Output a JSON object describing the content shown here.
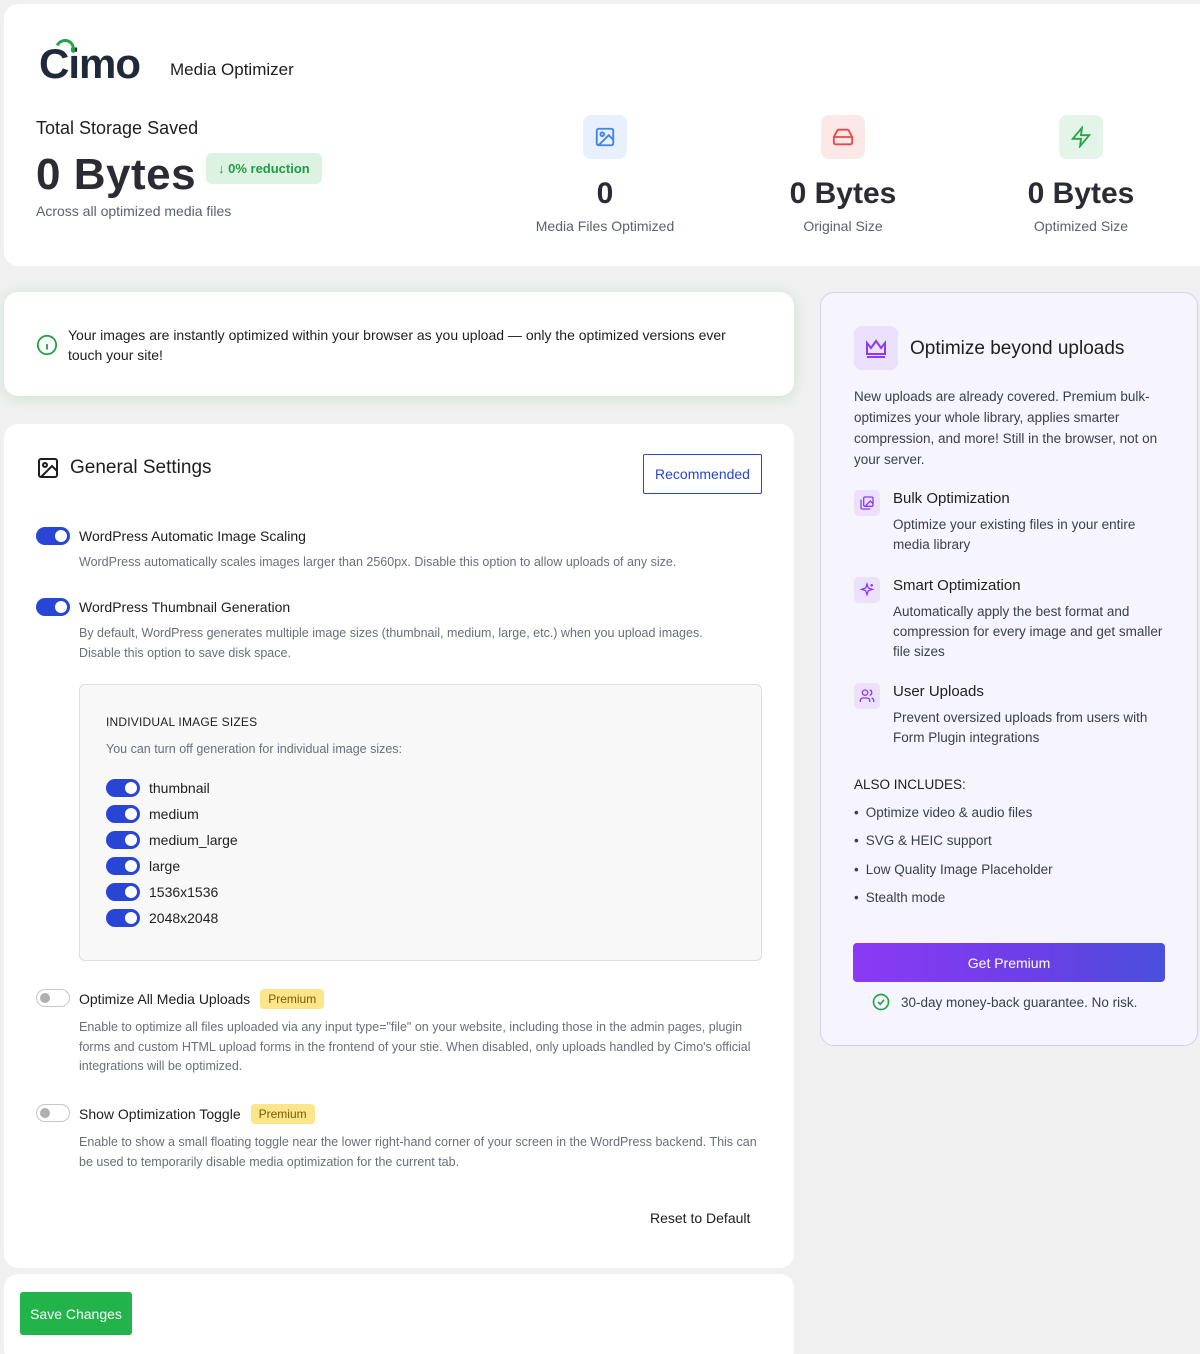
{
  "header": {
    "brand": "Cimo",
    "subtitle": "Media Optimizer",
    "total_label": "Total Storage Saved",
    "total_value": "0 Bytes",
    "reduction_badge": "↓ 0% reduction",
    "total_caption": "Across all optimized media files",
    "stats": [
      {
        "value": "0",
        "label": "Media Files Optimized",
        "icon": "image-icon",
        "color": "#3b82f6"
      },
      {
        "value": "0 Bytes",
        "label": "Original Size",
        "icon": "hard-drive-icon",
        "color": "#ef4444"
      },
      {
        "value": "0 Bytes",
        "label": "Optimized Size",
        "icon": "lightning-icon",
        "color": "#22a447"
      }
    ]
  },
  "info_banner": {
    "text": "Your images are instantly optimized within your browser as you upload — only the optimized versions ever touch your site!"
  },
  "settings": {
    "title": "General Settings",
    "recommended_label": "Recommended",
    "items": [
      {
        "label": "WordPress Automatic Image Scaling",
        "enabled": true,
        "description": "WordPress automatically scales images larger than 2560px. Disable this option to allow uploads of any size."
      },
      {
        "label": "WordPress Thumbnail Generation",
        "enabled": true,
        "description": "By default, WordPress generates multiple image sizes (thumbnail, medium, large, etc.) when you upload images. Disable this option to save disk space."
      },
      {
        "label": "Optimize All Media Uploads",
        "enabled": false,
        "badge": "Premium",
        "description": "Enable to optimize all files uploaded via any input type=\"file\" on your website, including those in the admin pages, plugin forms and custom HTML upload forms in the frontend of your stie. When disabled, only uploads handled by Cimo's official integrations will be optimized."
      },
      {
        "label": "Show Optimization Toggle",
        "enabled": false,
        "badge": "Premium",
        "description": "Enable to show a small floating toggle near the lower right-hand corner of your screen in the WordPress backend. This can be used to temporarily disable media optimization for the current tab."
      }
    ],
    "image_sizes": {
      "title": "INDIVIDUAL IMAGE SIZES",
      "subtitle": "You can turn off generation for individual image sizes:",
      "sizes": [
        {
          "name": "thumbnail",
          "enabled": true
        },
        {
          "name": "medium",
          "enabled": true
        },
        {
          "name": "medium_large",
          "enabled": true
        },
        {
          "name": "large",
          "enabled": true
        },
        {
          "name": "1536x1536",
          "enabled": true
        },
        {
          "name": "2048x2048",
          "enabled": true
        }
      ]
    },
    "reset_label": "Reset to Default"
  },
  "save": {
    "label": "Save Changes"
  },
  "promo": {
    "title": "Optimize beyond uploads",
    "description": "New uploads are already covered. Premium bulk-optimizes your whole library, applies smarter compression, and more! Still in the browser, not on your server.",
    "features": [
      {
        "title": "Bulk Optimization",
        "description": "Optimize your existing files in your entire media library",
        "icon": "images-icon"
      },
      {
        "title": "Smart Optimization",
        "description": "Automatically apply the best format and compression for every image and get smaller file sizes",
        "icon": "sparkles-icon"
      },
      {
        "title": "User Uploads",
        "description": "Prevent oversized uploads from users with Form Plugin integrations",
        "icon": "users-icon"
      }
    ],
    "also_label": "ALSO INCLUDES:",
    "also_items": [
      "Optimize video & audio files",
      "SVG & HEIC support",
      "Low Quality Image Placeholder",
      "Stealth mode"
    ],
    "cta_label": "Get Premium",
    "guarantee": "30-day money-back guarantee. No risk."
  }
}
